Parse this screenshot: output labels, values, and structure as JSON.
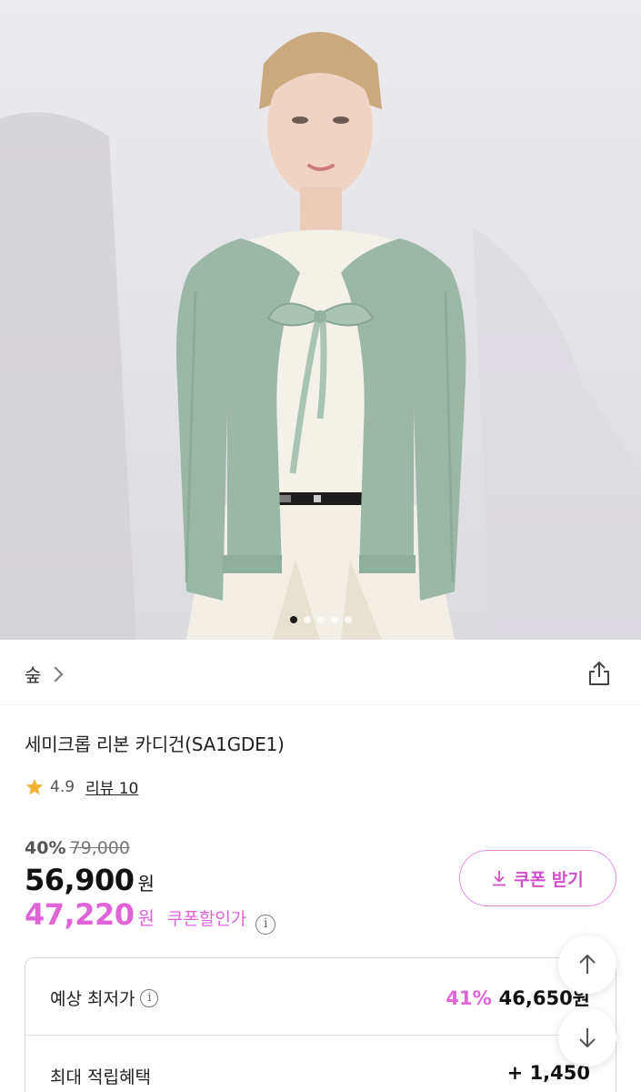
{
  "hero": {
    "slides_count": 5,
    "active_slide": 1,
    "colors": {
      "cardigan": "#9bb8a6",
      "inner_top": "#f4f1e9",
      "skirt": "#f3efe6",
      "background": "#e6e5e9"
    }
  },
  "breadcrumb": {
    "brand": "숲"
  },
  "product": {
    "name": "세미크롭 리본 카디건(SA1GDE1)",
    "rating": "4.9",
    "review_label": "리뷰 10"
  },
  "pricing": {
    "discount_rate": "40%",
    "original_price": "79,000",
    "sale_price": "56,900",
    "currency": "원",
    "coupon_price": "47,220",
    "coupon_label": "쿠폰할인가",
    "coupon_button": "쿠폰 받기"
  },
  "benefits": [
    {
      "label": "예상 최저가",
      "rate": "41%",
      "amount": "46,650원"
    },
    {
      "label": "최대 적립혜택",
      "rate": "",
      "amount": "+ 1,450"
    }
  ],
  "icons": {
    "share": "share-icon",
    "star": "star-icon",
    "download": "download-icon",
    "info": "info-icon",
    "scroll_up": "arrow-up-icon",
    "scroll_down": "arrow-down-icon"
  },
  "colors": {
    "accent": "#e064d8",
    "star": "#f5b335",
    "border": "#d9d9d9"
  }
}
